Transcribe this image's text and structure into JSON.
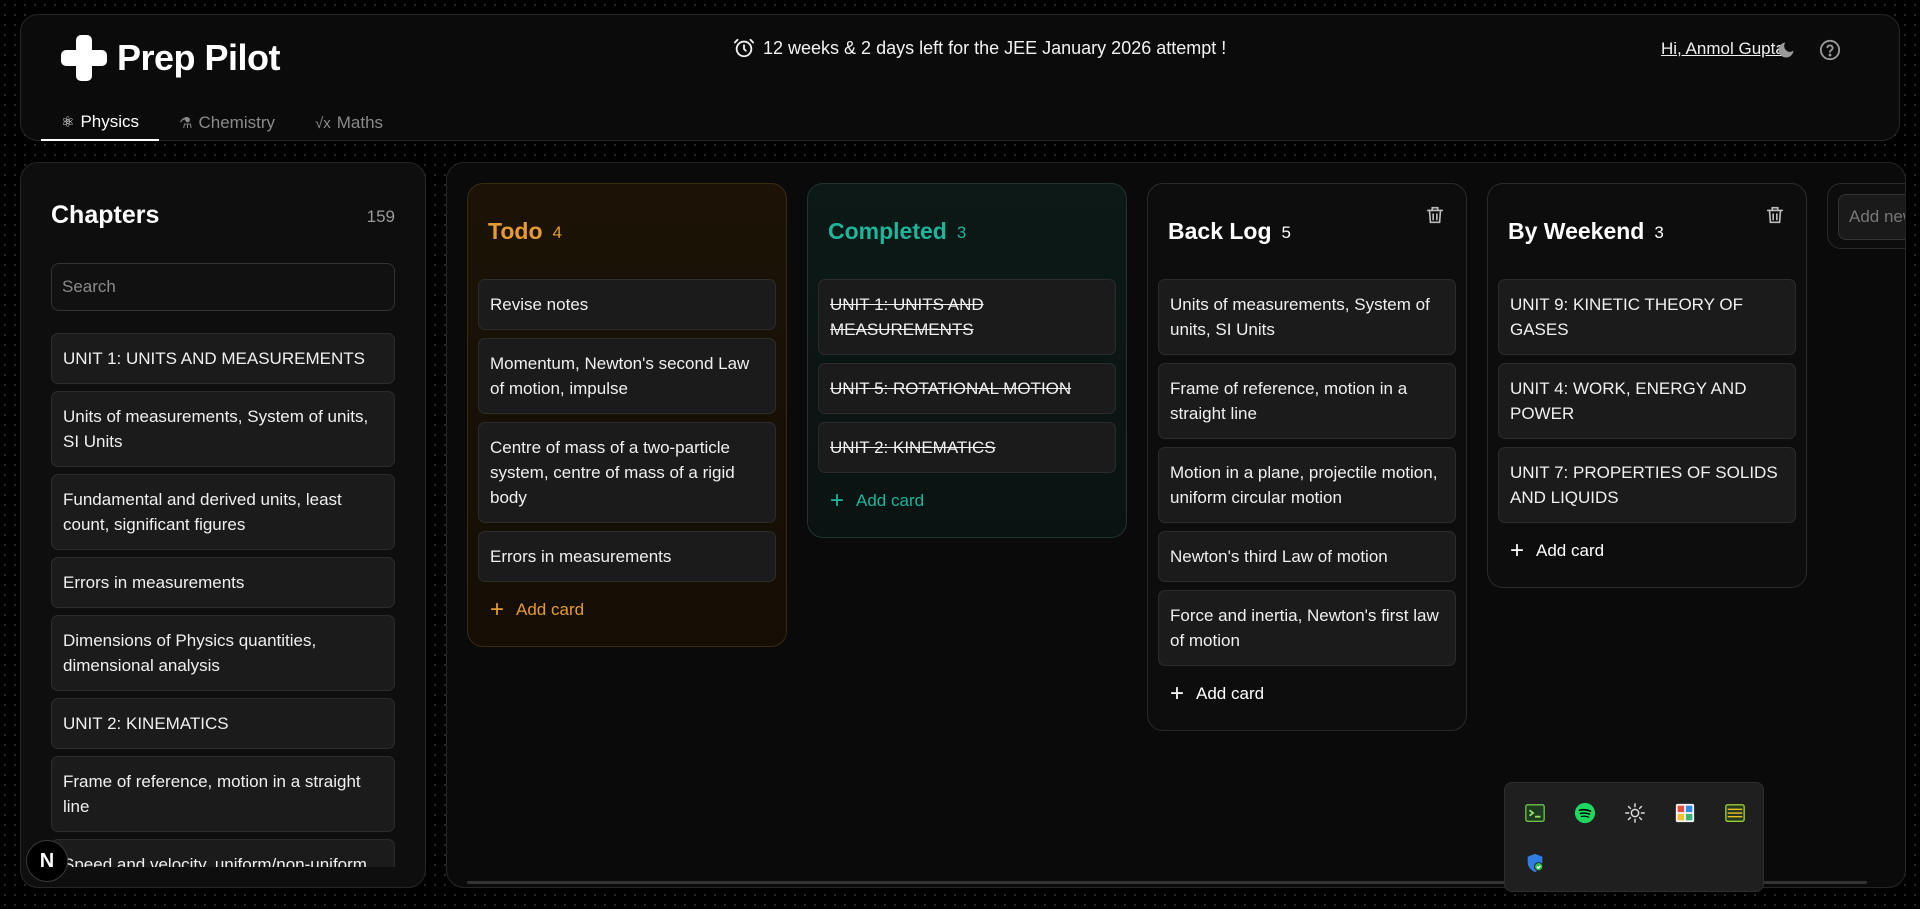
{
  "app": {
    "name": "Prep Pilot",
    "countdown": "12 weeks & 2 days left for the JEE January 2026 attempt !",
    "greeting": "Hi, Anmol Gupta"
  },
  "tabs": [
    {
      "label": "Physics",
      "icon": "physics-icon",
      "active": true
    },
    {
      "label": "Chemistry",
      "icon": "flask-icon",
      "active": false
    },
    {
      "label": "Maths",
      "icon": "sqrt-icon",
      "active": false
    }
  ],
  "sidebar": {
    "title": "Chapters",
    "count": "159",
    "search_placeholder": "Search",
    "chapters": [
      "UNIT 1: UNITS AND MEASUREMENTS",
      "Units of measurements, System of units, SI Units",
      "Fundamental and derived units, least count, significant figures",
      "Errors in measurements",
      "Dimensions of Physics quantities, dimensional analysis",
      "UNIT 2: KINEMATICS",
      "Frame of reference, motion in a straight line",
      "Speed and velocity, uniform/non-uniform motion"
    ]
  },
  "board": {
    "add_card_label": "Add card",
    "add_list_placeholder": "Add new list",
    "columns": [
      {
        "title": "Todo",
        "count": "4",
        "color": "#e69b30",
        "cards": [
          "Revise notes",
          "Momentum, Newton's second Law of motion, impulse",
          "Centre of mass of a two-particle system, centre of mass of a rigid body",
          "Errors in measurements"
        ]
      },
      {
        "title": "Completed",
        "count": "3",
        "color": "#1fb59a",
        "cards": [
          "UNIT 1: UNITS AND MEASUREMENTS",
          "UNIT 5: ROTATIONAL MOTION",
          "UNIT 2: KINEMATICS"
        ]
      },
      {
        "title": "Back Log",
        "count": "5",
        "color": "#ffffff",
        "cards": [
          "Units of measurements, System of units, SI Units",
          "Frame of reference, motion in a straight line",
          "Motion in a plane, projectile motion, uniform circular motion",
          "Newton's third Law of motion",
          "Force and inertia, Newton's first law of motion"
        ]
      },
      {
        "title": "By Weekend",
        "count": "3",
        "color": "#ffffff",
        "cards": [
          "UNIT 9: KINETIC THEORY OF GASES",
          "UNIT 4: WORK, ENERGY AND POWER",
          "UNIT 7: PROPERTIES OF SOLIDS AND LIQUIDS"
        ]
      }
    ]
  },
  "next_badge": "N"
}
